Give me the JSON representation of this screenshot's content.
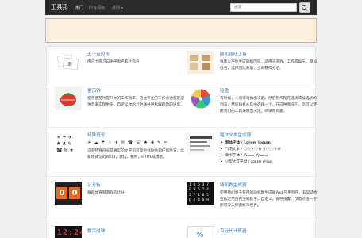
{
  "navbar": {
    "brand": "工具邦",
    "links": [
      {
        "label": "热门",
        "active": true
      },
      {
        "label": "所有项目",
        "active": false
      },
      {
        "label": "类别",
        "active": false
      }
    ],
    "search_placeholder": "搜索"
  },
  "tools": [
    {
      "title": "五十音闪卡",
      "desc": "用闪卡练习日语平假名和片假名"
    },
    {
      "title": "随机组队工具",
      "desc": "快速公平地生成随机团队。适用于游戏、工作或娱乐。添加姓名，选择团队数量，立即获得分组。"
    },
    {
      "title": "番茄钟",
      "desc": "使用番茄钟提升你的工作效率。通过专注的工作会话和定期休息来实现更多。自定义你的计时器并轻松跟踪你的进度。"
    },
    {
      "title": "轮盘",
      "desc": "有时候，人们很难做出决定。然后制作现有选项或候选项的列表，然后随机从其中选择一个。在这种情况下，您可以使用我们的工具来做出决定。简单而有趣。"
    },
    {
      "title": "特殊符号",
      "symbols": "☀ ☁ ☂ ☃ ✈ ✉ ☎ ☏ ♠ ♣ ✎ ✂",
      "desc": "这些特殊符号是真实的文字和可复制并粘贴到任何地方，比如像微信的Word，微信，推特，HTML或博客。"
    },
    {
      "title": "酷炫文本生成器",
      "styles": [
        "粗体字体 / Lorem Ipsum",
        "气泡文本 / ⓁⓄⓇⒺⓂ ⒾⓅⓈⓊⓂ",
        "草书字体 / 𝓛𝓸𝓻𝓮𝓶 𝓘𝓹𝓼𝓾𝓶",
        "小型大写字母 / ʟᴏʀᴇᴍ ɪᴘsᴜᴍ"
      ]
    },
    {
      "title": "记分板",
      "desc": "跟踪体育和游戏的比分",
      "digits": [
        "0",
        "0"
      ]
    },
    {
      "title": "随机数生成器",
      "desc": "使用我们易于使用的随机数生成器Web应用程序，非常适合在指定范围内生成数字。自定义，保存设置，仅需点击一下即可深入探索概率世界。",
      "numbers": [
        "1 8 5 3 7",
        "0 9 6 2 4",
        "3 7 1 8 5",
        "6 2 4 0 9"
      ]
    },
    {
      "title": "数字时钟",
      "clock": "12:24"
    },
    {
      "title": "百分比计算器"
    }
  ]
}
